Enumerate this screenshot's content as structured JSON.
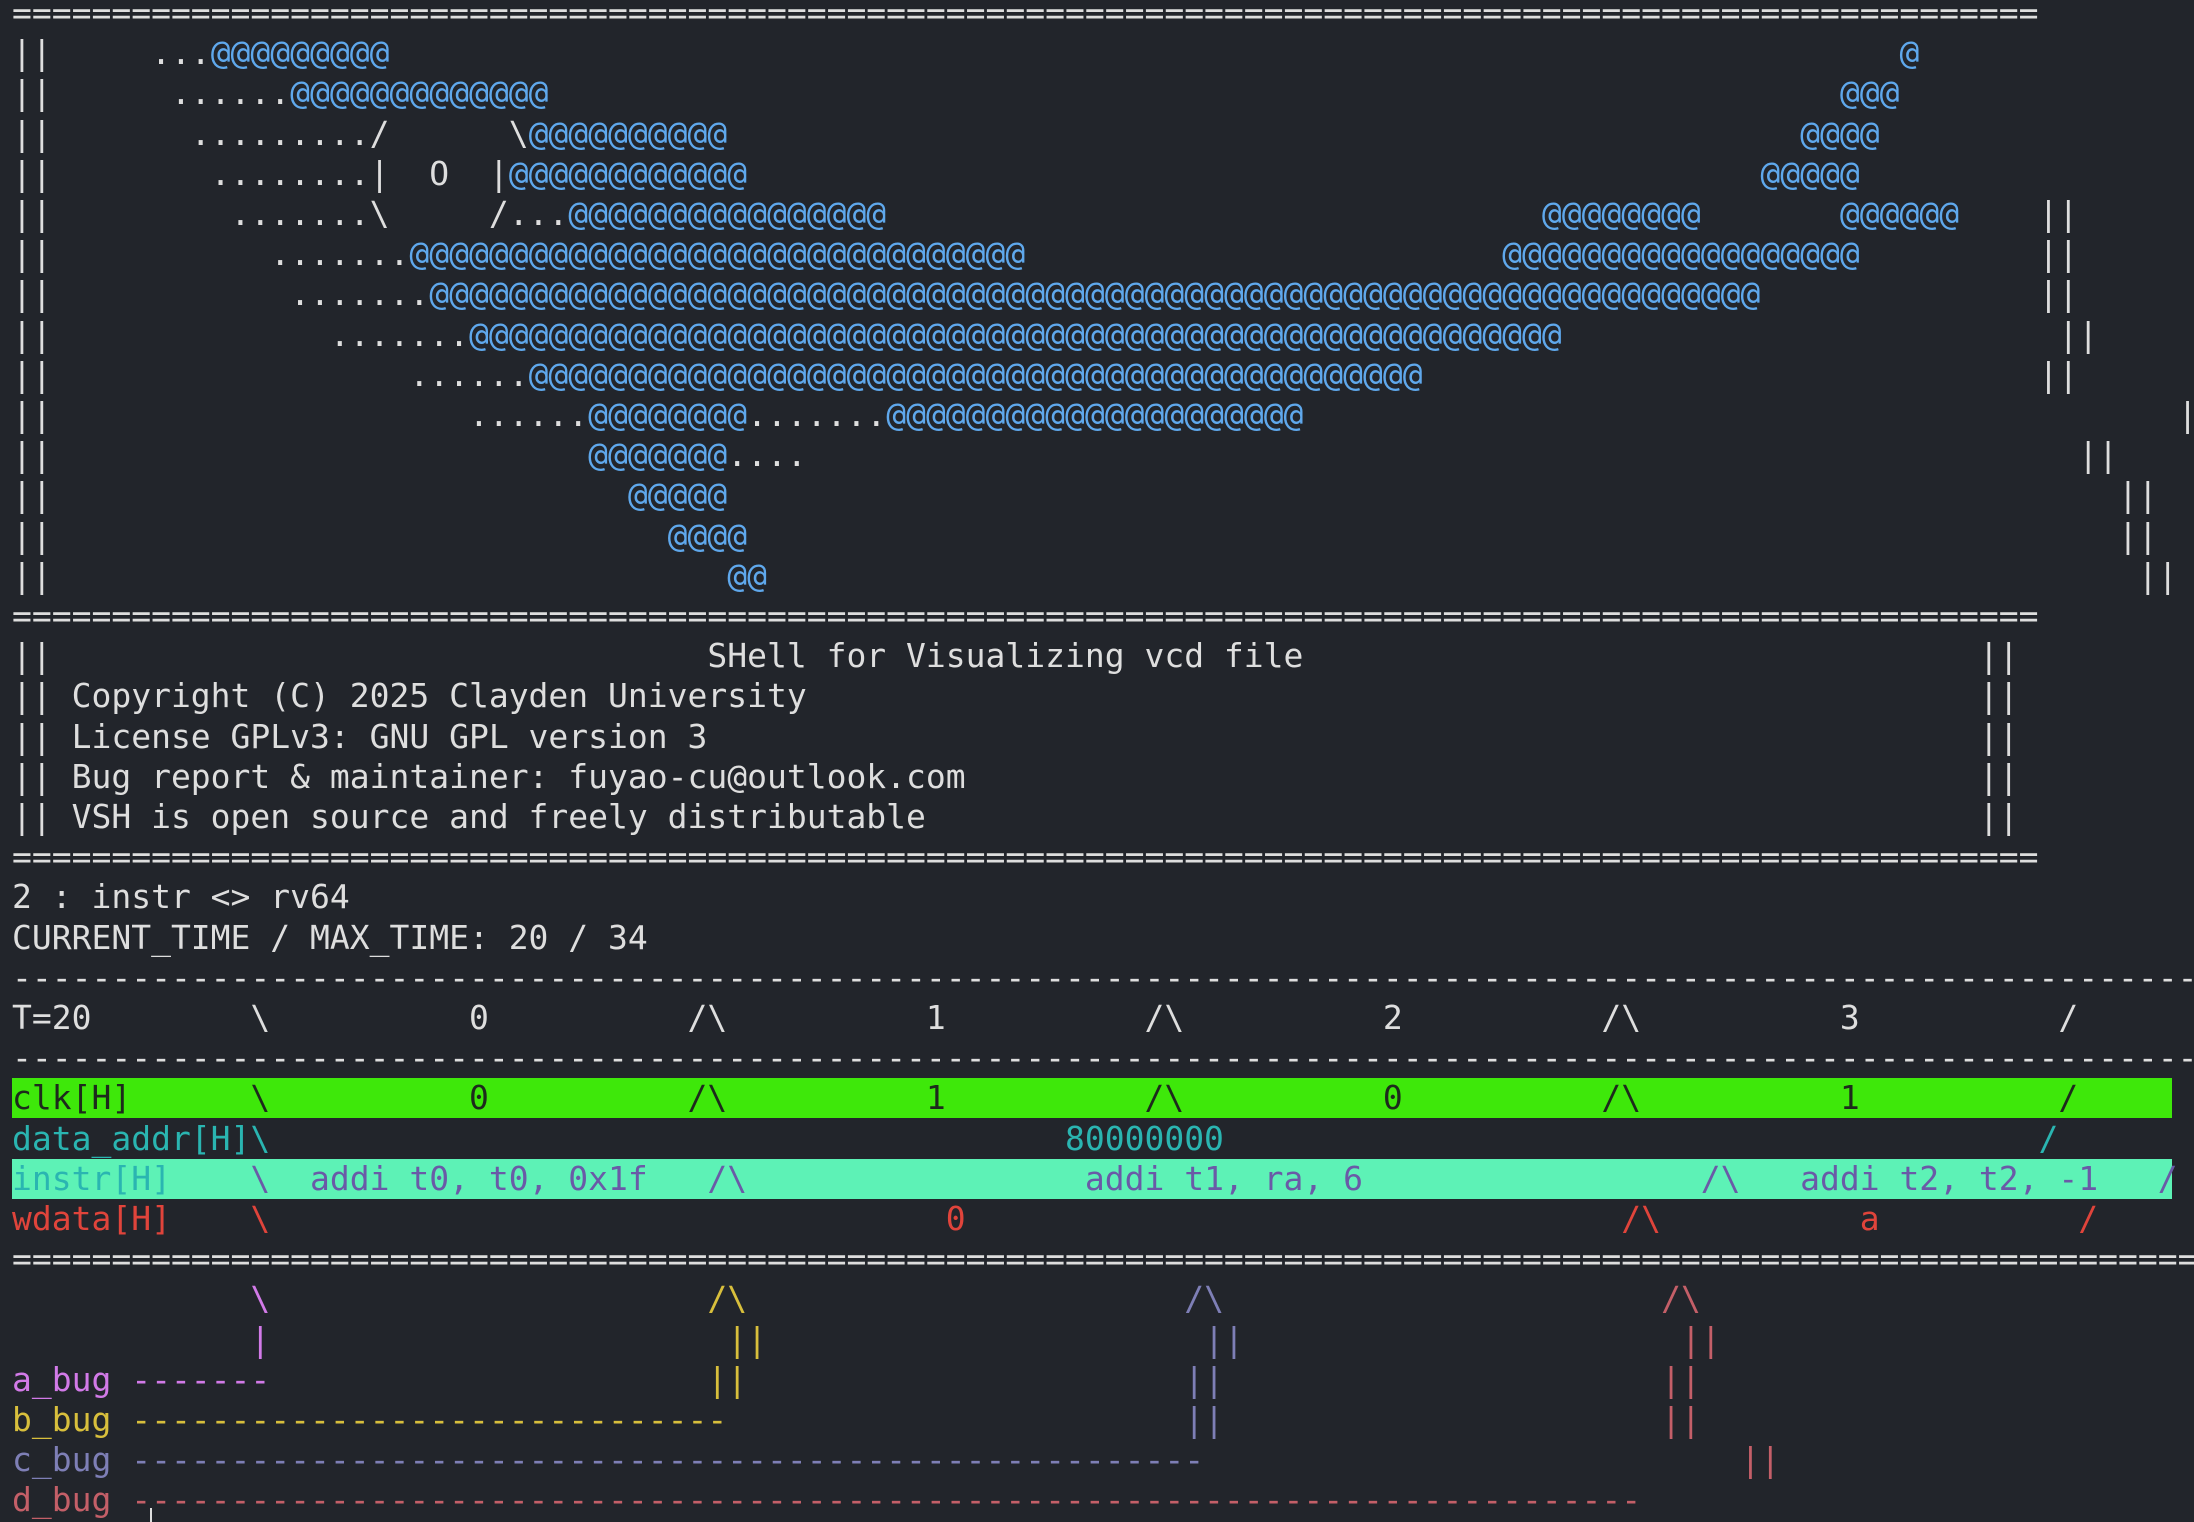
{
  "terminal": {
    "lines": [
      {
        "name": "border-top",
        "segments": [
          {
            "t": "======================================================================================================",
            "c": "white"
          }
        ]
      },
      {
        "name": "logo-line-1",
        "segments": [
          {
            "t": "||     ...",
            "c": "white"
          },
          {
            "t": "@@@@@@@@@",
            "c": "whale"
          },
          {
            "t": "                                                                            ",
            "c": "white"
          },
          {
            "t": "@",
            "c": "whale"
          },
          {
            "t": "                   ||",
            "c": "white"
          }
        ]
      },
      {
        "name": "logo-line-2",
        "segments": [
          {
            "t": "||      ......",
            "c": "white"
          },
          {
            "t": "@@@@@@@@@@@@@",
            "c": "whale"
          },
          {
            "t": "                                                                 ",
            "c": "white"
          },
          {
            "t": "@@@",
            "c": "whale"
          },
          {
            "t": "                   ||",
            "c": "white"
          }
        ]
      },
      {
        "name": "logo-line-3",
        "segments": [
          {
            "t": "||       ........./      \\",
            "c": "white"
          },
          {
            "t": "@@@@@@@@@@",
            "c": "whale"
          },
          {
            "t": "                                                      ",
            "c": "white"
          },
          {
            "t": "@@@@",
            "c": "whale"
          },
          {
            "t": "                    ||",
            "c": "white"
          }
        ]
      },
      {
        "name": "logo-line-4",
        "segments": [
          {
            "t": "||        ........|  O  |",
            "c": "white"
          },
          {
            "t": "@@@@@@@@@@@@",
            "c": "whale"
          },
          {
            "t": "                                                   ",
            "c": "white"
          },
          {
            "t": "@@@@@",
            "c": "whale"
          },
          {
            "t": "                    ||",
            "c": "white"
          }
        ]
      },
      {
        "name": "logo-line-5",
        "segments": [
          {
            "t": "||         .......\\     /...",
            "c": "white"
          },
          {
            "t": "@@@@@@@@@@@@@@@@",
            "c": "whale"
          },
          {
            "t": "                                 ",
            "c": "white"
          },
          {
            "t": "@@@@@@@@",
            "c": "whale"
          },
          {
            "t": "       ",
            "c": "white"
          },
          {
            "t": "@@@@@@",
            "c": "whale"
          },
          {
            "t": "    ||",
            "c": "white"
          }
        ]
      },
      {
        "name": "logo-line-6",
        "segments": [
          {
            "t": "||           .......",
            "c": "white"
          },
          {
            "t": "@@@@@@@@@@@@@@@@@@@@@@@@@@@@@@@",
            "c": "whale"
          },
          {
            "t": "                        ",
            "c": "white"
          },
          {
            "t": "@@@@@@@@@@@@@@@@@@",
            "c": "whale"
          },
          {
            "t": "         ||",
            "c": "white"
          }
        ]
      },
      {
        "name": "logo-line-7",
        "segments": [
          {
            "t": "||            .......",
            "c": "white"
          },
          {
            "t": "@@@@@@@@@@@@@@@@@@@@@@@@@@@@@@@@@@@@@@@@@@@@@@@@@@@@@@@@@@@@@@@@@@@",
            "c": "whale"
          },
          {
            "t": "              ||",
            "c": "white"
          }
        ]
      },
      {
        "name": "logo-line-8",
        "segments": [
          {
            "t": "||              .......",
            "c": "white"
          },
          {
            "t": "@@@@@@@@@@@@@@@@@@@@@@@@@@@@@@@@@@@@@@@@@@@@@@@@@@@@@@@",
            "c": "whale"
          },
          {
            "t": "                         ||",
            "c": "white"
          }
        ]
      },
      {
        "name": "logo-line-9",
        "segments": [
          {
            "t": "||                  ......",
            "c": "white"
          },
          {
            "t": "@@@@@@@@@@@@@@@@@@@@@@@@@@@@@@@@@@@@@@@@@@@@@",
            "c": "whale"
          },
          {
            "t": "                               ||",
            "c": "white"
          }
        ]
      },
      {
        "name": "logo-line-10",
        "segments": [
          {
            "t": "||                     ......",
            "c": "white"
          },
          {
            "t": "@@@@@@@@",
            "c": "whale"
          },
          {
            "t": ".......",
            "c": "white"
          },
          {
            "t": "@@@@@@@@@@@@@@@@@@@@@",
            "c": "whale"
          },
          {
            "t": "                                            ||",
            "c": "white"
          }
        ]
      },
      {
        "name": "logo-line-11",
        "segments": [
          {
            "t": "||                           ",
            "c": "white"
          },
          {
            "t": "@@@@@@@",
            "c": "whale"
          },
          {
            "t": "....                                                                ||",
            "c": "white"
          }
        ]
      },
      {
        "name": "logo-line-12",
        "segments": [
          {
            "t": "||                             ",
            "c": "white"
          },
          {
            "t": "@@@@@",
            "c": "whale"
          },
          {
            "t": "                                                                      ||",
            "c": "white"
          }
        ]
      },
      {
        "name": "logo-line-13",
        "segments": [
          {
            "t": "||                               ",
            "c": "white"
          },
          {
            "t": "@@@@",
            "c": "whale"
          },
          {
            "t": "                                                                     ||",
            "c": "white"
          }
        ]
      },
      {
        "name": "logo-line-14",
        "segments": [
          {
            "t": "||                                  ",
            "c": "white"
          },
          {
            "t": "@@",
            "c": "whale"
          },
          {
            "t": "                                                                     ||",
            "c": "white"
          }
        ]
      },
      {
        "name": "border-mid",
        "segments": [
          {
            "t": "======================================================================================================",
            "c": "white"
          }
        ]
      },
      {
        "name": "banner-title",
        "segments": [
          {
            "t": "||                                 SHell for Visualizing vcd file                                  ||",
            "c": "white"
          }
        ]
      },
      {
        "name": "banner-copyright",
        "segments": [
          {
            "t": "|| Copyright (C) 2025 Clayden University                                                           ||",
            "c": "white"
          }
        ]
      },
      {
        "name": "banner-license",
        "segments": [
          {
            "t": "|| License GPLv3: GNU GPL version 3                                                                ||",
            "c": "white"
          }
        ]
      },
      {
        "name": "banner-bug-report",
        "segments": [
          {
            "t": "|| Bug report & maintainer: fuyao-cu@outlook.com                                                   ||",
            "c": "white"
          }
        ]
      },
      {
        "name": "banner-open-source",
        "segments": [
          {
            "t": "|| VSH is open source and freely distributable                                                     ||",
            "c": "white"
          }
        ]
      },
      {
        "name": "border-bottom",
        "segments": [
          {
            "t": "======================================================================================================",
            "c": "white"
          }
        ]
      },
      {
        "name": "status-signal",
        "segments": [
          {
            "t": "2 : instr <> rv64",
            "c": "white"
          }
        ]
      },
      {
        "name": "status-time",
        "segments": [
          {
            "t": "CURRENT_TIME / MAX_TIME: 20 / 34",
            "c": "white"
          }
        ]
      },
      {
        "name": "wave-dash-top",
        "segments": [
          {
            "t": "--------------------------------------------------------------------------------------------------------------",
            "c": "white"
          }
        ]
      },
      {
        "name": "wave-time-ruler",
        "segments": [
          {
            "t": "T=20        \\          0          /\\          1          /\\          2          /\\          3          /",
            "c": "white"
          }
        ]
      },
      {
        "name": "wave-dash-bottom",
        "segments": [
          {
            "t": "--------------------------------------------------------------------------------------------------------------",
            "c": "white"
          }
        ]
      },
      {
        "name": "signal-clk",
        "segments": [
          {
            "t": "clk[H]      \\          0          /\\          1          /\\          0          /\\          1          /",
            "c": "dark",
            "bg": "green"
          }
        ]
      },
      {
        "name": "signal-data-addr",
        "segments": [
          {
            "t": "data_addr[H]\\                                        80000000                                         /",
            "c": "teal"
          }
        ]
      },
      {
        "name": "signal-instr",
        "segments": [
          {
            "t": "instr[H]",
            "c": "teal"
          },
          {
            "t": "    \\  addi t0, t0, 0x1f   /\\                 addi t1, ra, 6                 /\\   addi t2, t2, -1   /",
            "c": "purple"
          }
        ],
        "bg": "mint"
      },
      {
        "name": "signal-wdata",
        "segments": [
          {
            "t": "wdata[H]    \\                                  0                                 /\\          a          /",
            "c": "red"
          }
        ]
      },
      {
        "name": "border-wave-end",
        "segments": [
          {
            "t": "==============================================================================================================",
            "c": "white"
          }
        ]
      },
      {
        "name": "bug-marker-row-1",
        "segments": [
          {
            "t": "            ",
            "c": "white"
          },
          {
            "t": "\\",
            "c": "magenta"
          },
          {
            "t": "                      ",
            "c": "white"
          },
          {
            "t": "/\\",
            "c": "yellow"
          },
          {
            "t": "                      ",
            "c": "white"
          },
          {
            "t": "/\\",
            "c": "lavender"
          },
          {
            "t": "                      ",
            "c": "white"
          },
          {
            "t": "/\\",
            "c": "rose"
          }
        ]
      },
      {
        "name": "bug-marker-row-2",
        "segments": [
          {
            "t": "            ",
            "c": "white"
          },
          {
            "t": "|",
            "c": "magenta"
          },
          {
            "t": "                       ",
            "c": "white"
          },
          {
            "t": "||",
            "c": "yellow"
          },
          {
            "t": "                      ",
            "c": "white"
          },
          {
            "t": "||",
            "c": "lavender"
          },
          {
            "t": "                      ",
            "c": "white"
          },
          {
            "t": "||",
            "c": "rose"
          }
        ]
      },
      {
        "name": "bug-a",
        "segments": [
          {
            "t": "a_bug -------",
            "c": "magenta"
          },
          {
            "t": "                      ",
            "c": "white"
          },
          {
            "t": "||",
            "c": "yellow"
          },
          {
            "t": "                      ",
            "c": "white"
          },
          {
            "t": "||",
            "c": "lavender"
          },
          {
            "t": "                      ",
            "c": "white"
          },
          {
            "t": "||",
            "c": "rose"
          }
        ]
      },
      {
        "name": "bug-b",
        "segments": [
          {
            "t": "b_bug ------------------------------",
            "c": "yellow"
          },
          {
            "t": "                       ",
            "c": "white"
          },
          {
            "t": "||",
            "c": "lavender"
          },
          {
            "t": "                      ",
            "c": "white"
          },
          {
            "t": "||",
            "c": "rose"
          }
        ]
      },
      {
        "name": "bug-c",
        "segments": [
          {
            "t": "c_bug ------------------------------------------------------",
            "c": "lavender"
          },
          {
            "t": "                           ",
            "c": "white"
          },
          {
            "t": "||",
            "c": "rose"
          }
        ]
      },
      {
        "name": "bug-d",
        "segments": [
          {
            "t": "d_bug ----------------------------------------------------------------------------",
            "c": "rose"
          }
        ]
      }
    ]
  }
}
